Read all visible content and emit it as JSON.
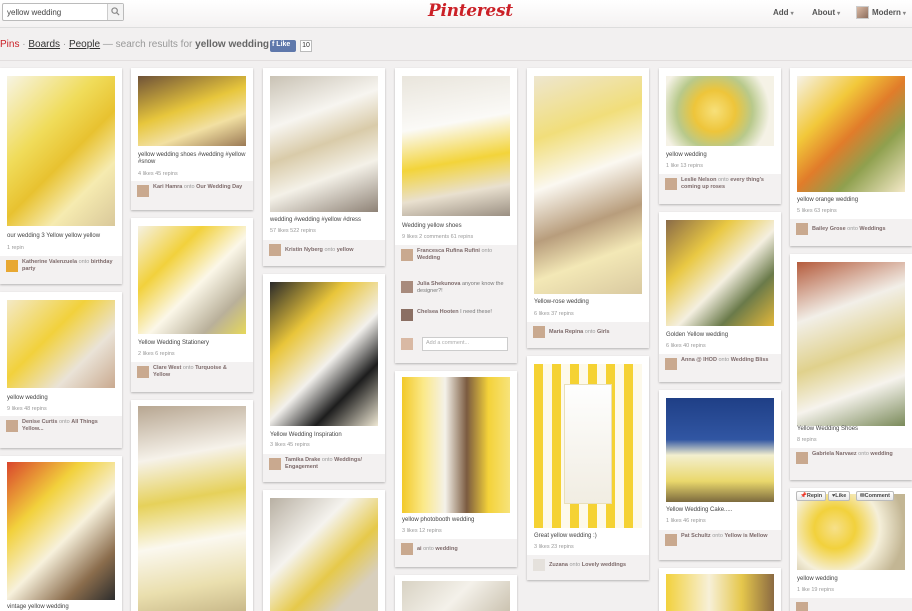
{
  "header": {
    "search_value": "yellow wedding",
    "logo": "Pinterest",
    "add_label": "Add",
    "about_label": "About",
    "user_label": "Modern"
  },
  "subbar": {
    "pins": "Pins",
    "sep": "·",
    "boards": "Boards",
    "people": "People",
    "prefix": "— search results for",
    "query": "yellow wedding",
    "like_label": "Like",
    "like_count": "10"
  },
  "ui": {
    "onto": "onto",
    "add_comment": "Add a comment...",
    "repin": "Repin",
    "like": "Like",
    "comment": "Comment"
  },
  "colors": {
    "brand": "#cb2027",
    "yellow": "#f2d13c",
    "page_bg": "#f2f0f0"
  },
  "pins": [
    {
      "caption": "our wedding 3 Yellow yellow yellow",
      "stats": "1 repin",
      "user": "Katherine Valenzuela",
      "board": "birthday party"
    },
    {
      "caption": "yellow wedding",
      "stats": "9 likes  48 repins",
      "user": "Denise Curtis",
      "board": "All Things Yellow..."
    },
    {
      "caption": "vintage yellow wedding"
    },
    {
      "caption": "yellow wedding shoes #wedding #yellow #snow",
      "stats": "4 likes  45 repins",
      "user": "Kari Hamra",
      "board": "Our Wedding Day"
    },
    {
      "caption": "Yellow Wedding Stationery",
      "stats": "2 likes  6 repins",
      "user": "Clare West",
      "board": "Turquoise & Yellow"
    },
    {
      "caption": "wedding #wedding #yellow #dress",
      "stats": "57 likes  522 repins",
      "user": "Kristin Nyberg",
      "board": "yellow"
    },
    {
      "caption": "Yellow Wedding Inspiration",
      "stats": "3 likes  45 repins",
      "user": "Tamika Drake",
      "board": "Weddings/ Engagement"
    },
    {
      "caption": "Wedding yellow shoes",
      "stats": "9 likes  2 comments  61 repins",
      "user": "Francesca Rufina Rufini",
      "board": "Wedding",
      "comments": [
        {
          "user": "Julia Shekunova",
          "text": "anyone know the designer?!"
        },
        {
          "user": "Chelsea Hooten",
          "text": "I need these!"
        }
      ]
    },
    {
      "caption": "yellow photobooth wedding",
      "stats": "3 likes  12 repins",
      "user": "ai",
      "board": "wedding"
    },
    {
      "caption": "Yellow-rose wedding",
      "stats": "6 likes  37 repins",
      "user": "Maria Repina",
      "board": "Girls"
    },
    {
      "caption": "Great yellow wedding :)",
      "stats": "3 likes  23 repins",
      "user": "Zuzana",
      "board": "Lovely weddings"
    },
    {
      "caption": "yellow wedding",
      "stats": "1 like  13 repins",
      "user": "Leslie Nelson",
      "board": "every thing's coming up roses"
    },
    {
      "caption": "Golden Yellow wedding",
      "stats": "6 likes  40 repins",
      "user": "Anna @ IHOD",
      "board": "Wedding Bliss"
    },
    {
      "caption": "Yellow Wedding Cake.....",
      "stats": "1 likes  46 repins",
      "user": "Pat Schultz",
      "board": "Yellow is Mellow"
    },
    {
      "caption": "yellow orange wedding",
      "stats": "5 likes  63 repins",
      "user": "Bailey Grose",
      "board": "Weddings"
    },
    {
      "caption": "Yellow Wedding Shoes",
      "stats": "8 repins",
      "user": "Gabriela Narvaez",
      "board": "wedding"
    },
    {
      "caption": "yellow wedding",
      "stats": "1 like  19 repins"
    }
  ]
}
